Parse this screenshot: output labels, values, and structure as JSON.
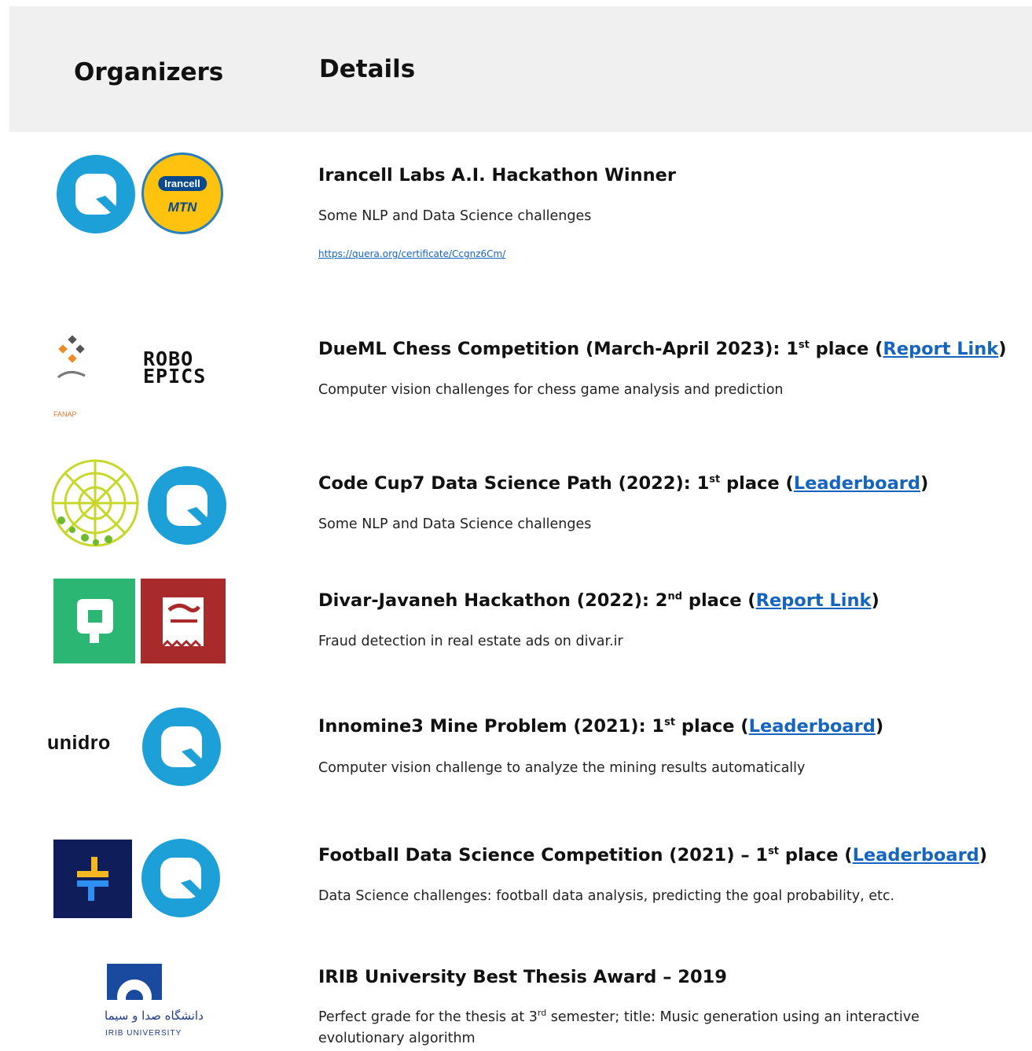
{
  "header": {
    "organizers": "Organizers",
    "details": "Details"
  },
  "icons": {
    "quera": "quera-logo-icon",
    "irancell": "irancell-mtn-logo-icon",
    "fanap": "fanap-logo-icon",
    "roboepics": "roboepics-logo-icon",
    "codecup": "codecup-logo-icon",
    "javaneh": "javaneh-logo-icon",
    "divar": "divar-logo-icon",
    "unidro": "unidro-logo-icon",
    "football": "football-platform-logo-icon",
    "irib": "irib-university-logo-icon"
  },
  "colors": {
    "quera_blue": "#1d9fd8",
    "link": "#1565c0",
    "header_bg": "#f0f0f0"
  },
  "logos": {
    "irancell_top": "Irancell",
    "irancell_bottom": "MTN",
    "fanap": "FANAP",
    "robo_line1": "ROBO",
    "robo_line2": "EPICS",
    "unidro": "unidro",
    "irib_fa": "دانشگاه صدا و سیما",
    "irib_en": "IRIB UNIVERSITY"
  },
  "entries": {
    "irancell": {
      "title": "Irancell Labs A.I. Hackathon Winner",
      "description": "Some NLP and Data Science challenges",
      "url": "https://quera.org/certificate/Ccgnz6Cm/"
    },
    "dueml": {
      "title_pre": "DueML Chess Competition (March-April 2023): 1",
      "sup": "st",
      "title_post": " place (",
      "link": "Report Link",
      "close": ")",
      "description": "Computer vision challenges for chess game analysis and prediction"
    },
    "codecup": {
      "title_pre": "Code Cup7 Data Science Path (2022): 1",
      "sup": "st",
      "title_post": " place  (",
      "link": "Leaderboard",
      "close": ")",
      "description": "Some NLP and Data Science challenges"
    },
    "divar": {
      "title_pre": "Divar-Javaneh Hackathon (2022): 2",
      "sup": "nd",
      "title_post": " place (",
      "link": "Report Link",
      "close": ")",
      "description": "Fraud detection in real estate ads on divar.ir"
    },
    "innomine": {
      "title_pre": "Innomine3 Mine Problem (2021): 1",
      "sup": "st",
      "title_post": " place (",
      "link": "Leaderboard",
      "close": ")",
      "description": "Computer vision challenge to analyze the mining results automatically"
    },
    "football": {
      "title_pre": "Football Data Science Competition (2021) – 1",
      "sup": "st",
      "title_post": " place (",
      "link": "Leaderboard",
      "close": ")",
      "description": "Data Science challenges: football data analysis, predicting the goal probability, etc."
    },
    "irib": {
      "title": "IRIB University Best Thesis Award – 2019",
      "desc_pre": "Perfect grade for the thesis at 3",
      "desc_sup": "rd",
      "desc_post": " semester; title: Music generation using an interactive",
      "desc_line2": "evolutionary algorithm"
    }
  }
}
